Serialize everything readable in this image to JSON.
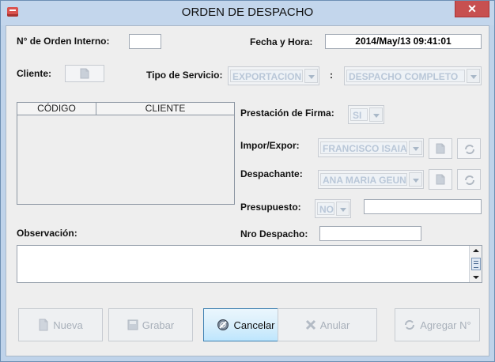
{
  "window": {
    "title": "ORDEN DE DESPACHO",
    "close_glyph": "✕"
  },
  "form": {
    "orden_label": "N° de Orden Interno:",
    "orden_value": "",
    "fecha_label": "Fecha y Hora:",
    "fecha_value": "2014/May/13 09:41:01",
    "cliente_label": "Cliente:",
    "tipo_servicio_label": "Tipo de Servicio:",
    "tipo_servicio_value": "EXPORTACION",
    "colon": ":",
    "servicio_detalle_value": "DESPACHO COMPLETO",
    "prestacion_label": "Prestación de Firma:",
    "prestacion_value": "SI",
    "impor_label": "Impor/Expor:",
    "impor_value": "FRANCISCO ISAIA...",
    "despachante_label": "Despachante:",
    "despachante_value": "ANA MARIA GEUNA",
    "presupuesto_label": "Presupuesto:",
    "presupuesto_value": "NO",
    "presupuesto_text": "",
    "nro_despacho_label": "Nro Despacho:",
    "nro_despacho_value": "",
    "observacion_label": "Observación:",
    "observacion_value": ""
  },
  "table": {
    "columns": [
      "CÓDIGO",
      "CLIENTE"
    ],
    "rows": []
  },
  "buttons": {
    "nueva": "Nueva",
    "grabar": "Grabar",
    "cancelar": "Cancelar",
    "anular": "Anular",
    "agregar": "Agregar N°"
  },
  "colors": {
    "title_bar": "#c3d6ec",
    "close": "#c75050",
    "disabled_text": "#b9c7d8",
    "panel": "#eeeeee"
  },
  "icons": [
    "app-icon",
    "close-icon",
    "document-icon",
    "refresh-icon",
    "save-icon",
    "cancel-icon",
    "delete-icon",
    "add-number-icon"
  ]
}
